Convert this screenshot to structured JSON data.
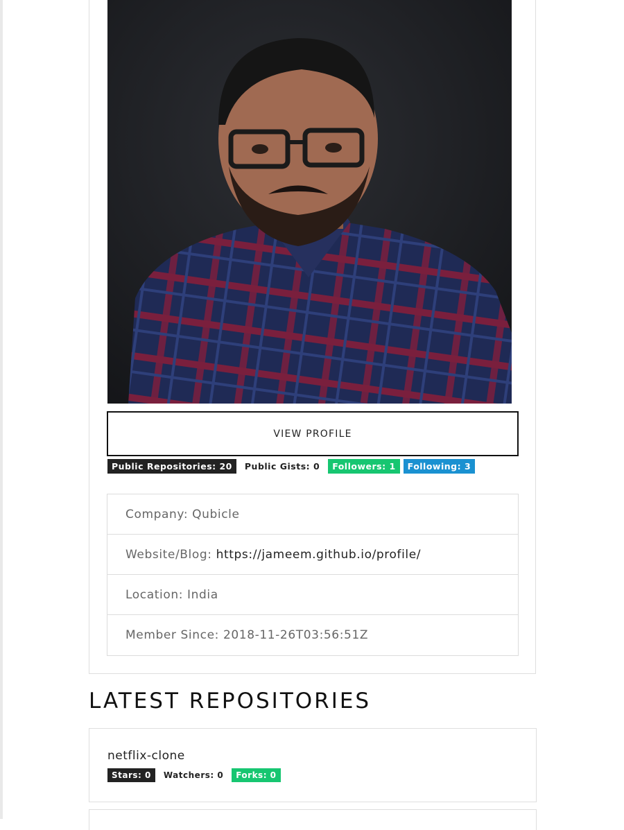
{
  "profile": {
    "avatar_icon": "profile-photo",
    "view_profile_label": "VIEW PROFILE",
    "badges": {
      "repos": "Public Repositories: 20",
      "gists": "Public Gists: 0",
      "followers": "Followers: 1",
      "following": "Following: 3"
    },
    "details": {
      "company": "Company: Qubicle",
      "website_label": "Website/Blog:",
      "website_value": "https://jameem.github.io/profile/",
      "location": "Location: India",
      "member_since": "Member Since: 2018-11-26T03:56:51Z"
    }
  },
  "repos_section": {
    "title": "LATEST REPOSITORIES",
    "items": [
      {
        "name": "netflix-clone",
        "stars": "Stars: 0",
        "watchers": "Watchers: 0",
        "forks": "Forks: 0"
      }
    ]
  },
  "colors": {
    "badge_dark": "#222222",
    "badge_green": "#17c671",
    "badge_blue": "#1a91d1"
  }
}
